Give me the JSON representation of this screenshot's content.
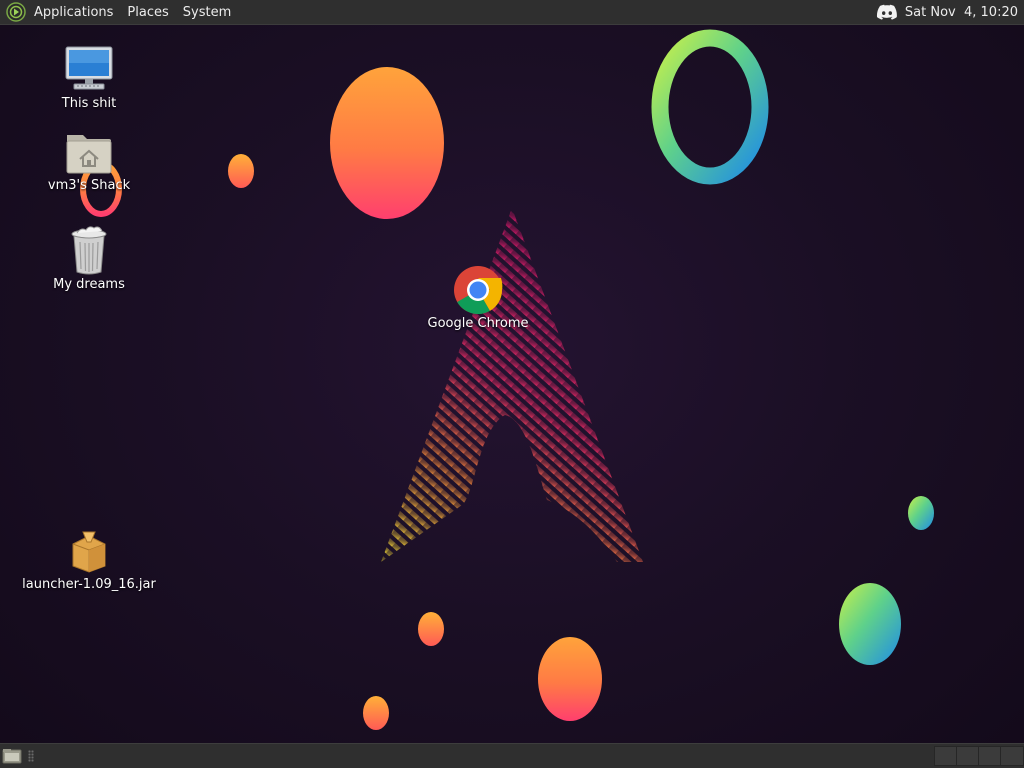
{
  "top_panel": {
    "menus": [
      "Applications",
      "Places",
      "System"
    ],
    "tray_icon": "discord-icon",
    "clock": "Sat Nov  4, 10:20"
  },
  "desktop": {
    "icons": [
      {
        "label": "This shit",
        "icon": "computer-icon"
      },
      {
        "label": "vm3's Shack",
        "icon": "home-folder-icon"
      },
      {
        "label": "My dreams",
        "icon": "trash-icon"
      },
      {
        "label": "Google Chrome",
        "icon": "chrome-icon"
      },
      {
        "label": "launcher-1.09_16.jar",
        "icon": "package-icon"
      }
    ]
  },
  "bottom_panel": {
    "left_icon": "show-desktop-icon",
    "workspaces": 4
  },
  "colors": {
    "panel_bg": "#2f2f2f",
    "desktop_bg": "#1b0f25",
    "accent_pink": "#e8196e",
    "accent_orange": "#ff9a3c"
  }
}
